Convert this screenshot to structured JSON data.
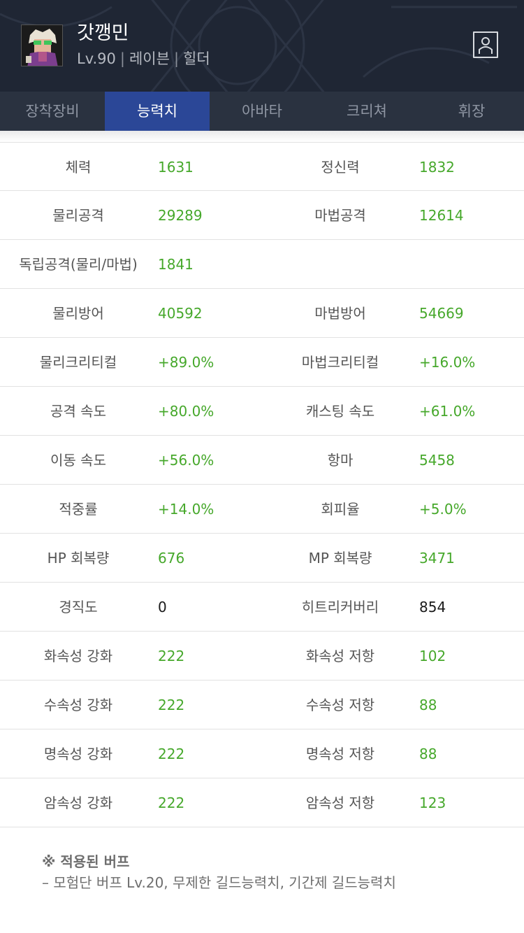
{
  "character": {
    "name": "갓깽민",
    "level": "Lv.90",
    "class": "레이븐",
    "job": "힐더"
  },
  "tabs": [
    {
      "label": "장착장비",
      "active": false
    },
    {
      "label": "능력치",
      "active": true
    },
    {
      "label": "아바타",
      "active": false
    },
    {
      "label": "크리쳐",
      "active": false
    },
    {
      "label": "휘장",
      "active": false
    }
  ],
  "stats": [
    {
      "l1": "체력",
      "v1": "1631",
      "l2": "정신력",
      "v2": "1832"
    },
    {
      "l1": "물리공격",
      "v1": "29289",
      "l2": "마법공격",
      "v2": "12614"
    },
    {
      "l1": "독립공격(물리/마법)",
      "v1": "1841",
      "l2": "",
      "v2": ""
    },
    {
      "l1": "물리방어",
      "v1": "40592",
      "l2": "마법방어",
      "v2": "54669"
    },
    {
      "l1": "물리크리티컬",
      "v1": "+89.0%",
      "l2": "마법크리티컬",
      "v2": "+16.0%"
    },
    {
      "l1": "공격 속도",
      "v1": "+80.0%",
      "l2": "캐스팅 속도",
      "v2": "+61.0%"
    },
    {
      "l1": "이동 속도",
      "v1": "+56.0%",
      "l2": "항마",
      "v2": "5458"
    },
    {
      "l1": "적중률",
      "v1": "+14.0%",
      "l2": "회피율",
      "v2": "+5.0%"
    },
    {
      "l1": "HP 회복량",
      "v1": "676",
      "l2": "MP 회복량",
      "v2": "3471"
    },
    {
      "l1": "경직도",
      "v1": "0",
      "l2": "히트리커버리",
      "v2": "854",
      "black": true
    },
    {
      "l1": "화속성 강화",
      "v1": "222",
      "l2": "화속성 저항",
      "v2": "102"
    },
    {
      "l1": "수속성 강화",
      "v1": "222",
      "l2": "수속성 저항",
      "v2": "88"
    },
    {
      "l1": "명속성 강화",
      "v1": "222",
      "l2": "명속성 저항",
      "v2": "88"
    },
    {
      "l1": "암속성 강화",
      "v1": "222",
      "l2": "암속성 저항",
      "v2": "123"
    }
  ],
  "buff": {
    "title": "※ 적용된 버프",
    "text": "– 모험단 버프 Lv.20, 무제한 길드능력치, 기간제 길드능력치"
  },
  "colors": {
    "header_bg": "#1f2634",
    "tab_bar_bg": "#2a3240",
    "tab_active": "#2b4797",
    "value_green": "#46a82b"
  },
  "icons": {
    "profile": "profile-card-icon",
    "avatar": "character-portrait"
  }
}
